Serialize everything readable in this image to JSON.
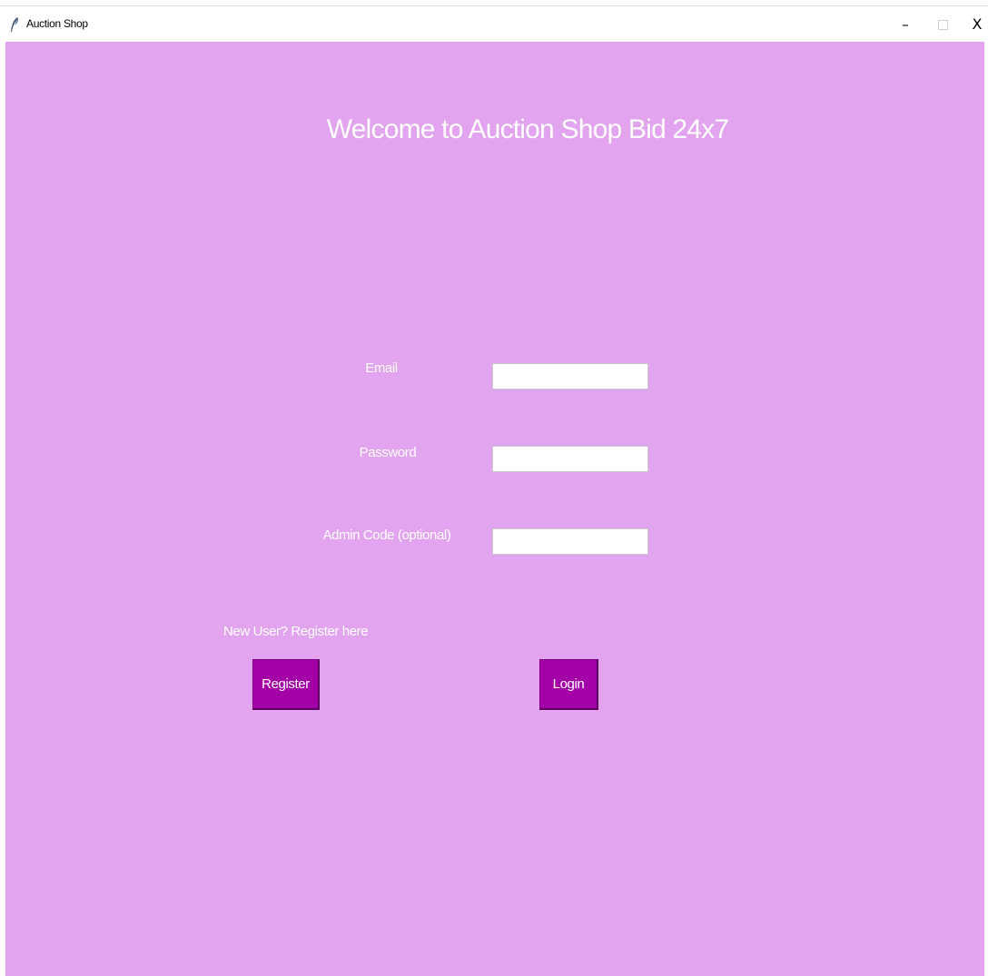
{
  "window": {
    "title": "Auction Shop",
    "minimize_glyph": "–",
    "close_glyph": "X",
    "icon": "feather-icon"
  },
  "main": {
    "heading": "Welcome to Auction Shop Bid 24x7",
    "background_color": "#e2a4ee",
    "fields": {
      "email": {
        "label": "Email",
        "value": "",
        "placeholder": ""
      },
      "password": {
        "label": "Password",
        "value": "",
        "placeholder": ""
      },
      "admin_code": {
        "label": "Admin Code (optional)",
        "value": "",
        "placeholder": ""
      }
    },
    "register_hint": "New User? Register here",
    "register_button": "Register",
    "login_button": "Login",
    "button_color": "#a400a8"
  }
}
